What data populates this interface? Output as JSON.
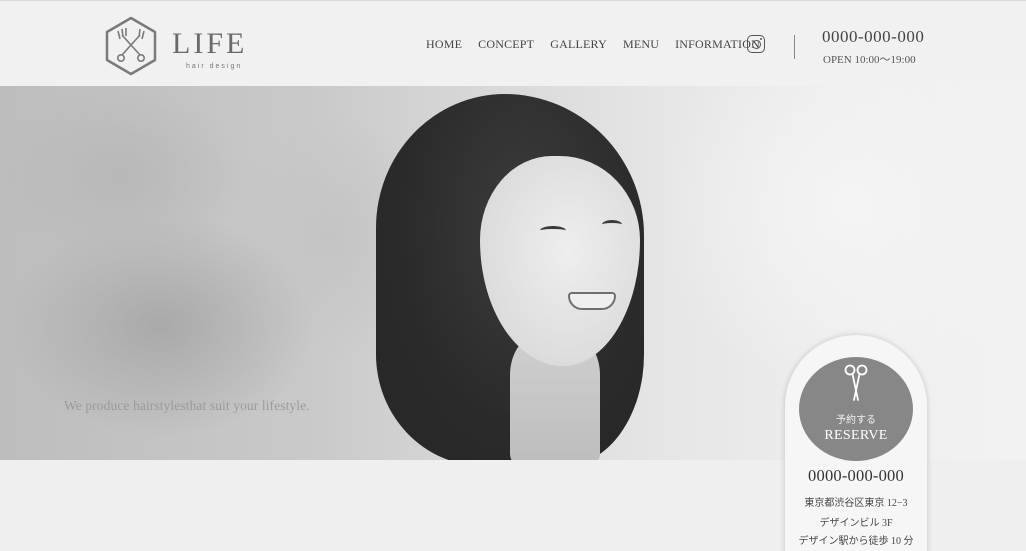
{
  "brand": {
    "name": "LIFE",
    "sub": "hair design",
    "logo_icon": "scissors-hexagon-icon"
  },
  "nav": {
    "items": [
      {
        "label": "HOME"
      },
      {
        "label": "CONCEPT"
      },
      {
        "label": "GALLERY"
      },
      {
        "label": "MENU"
      },
      {
        "label": "INFORMATION"
      }
    ],
    "instagram_icon": "instagram-icon"
  },
  "contact": {
    "phone": "0000-000-000",
    "hours": "OPEN 10:00～19:00"
  },
  "hero": {
    "tagline": "We produce hairstylesthat suit your lifestyle."
  },
  "reserve": {
    "icon": "scissors-icon",
    "small_label": "予約する",
    "label": "RESERVE",
    "phone": "0000-000-000",
    "address_line1": "東京都渋谷区東京 12−3",
    "address_line2": "デザインビル 3F",
    "address_line3": "デザイン駅から徒歩 10 分"
  },
  "colors": {
    "reserve_circle": "#878787",
    "background": "#efefef"
  }
}
